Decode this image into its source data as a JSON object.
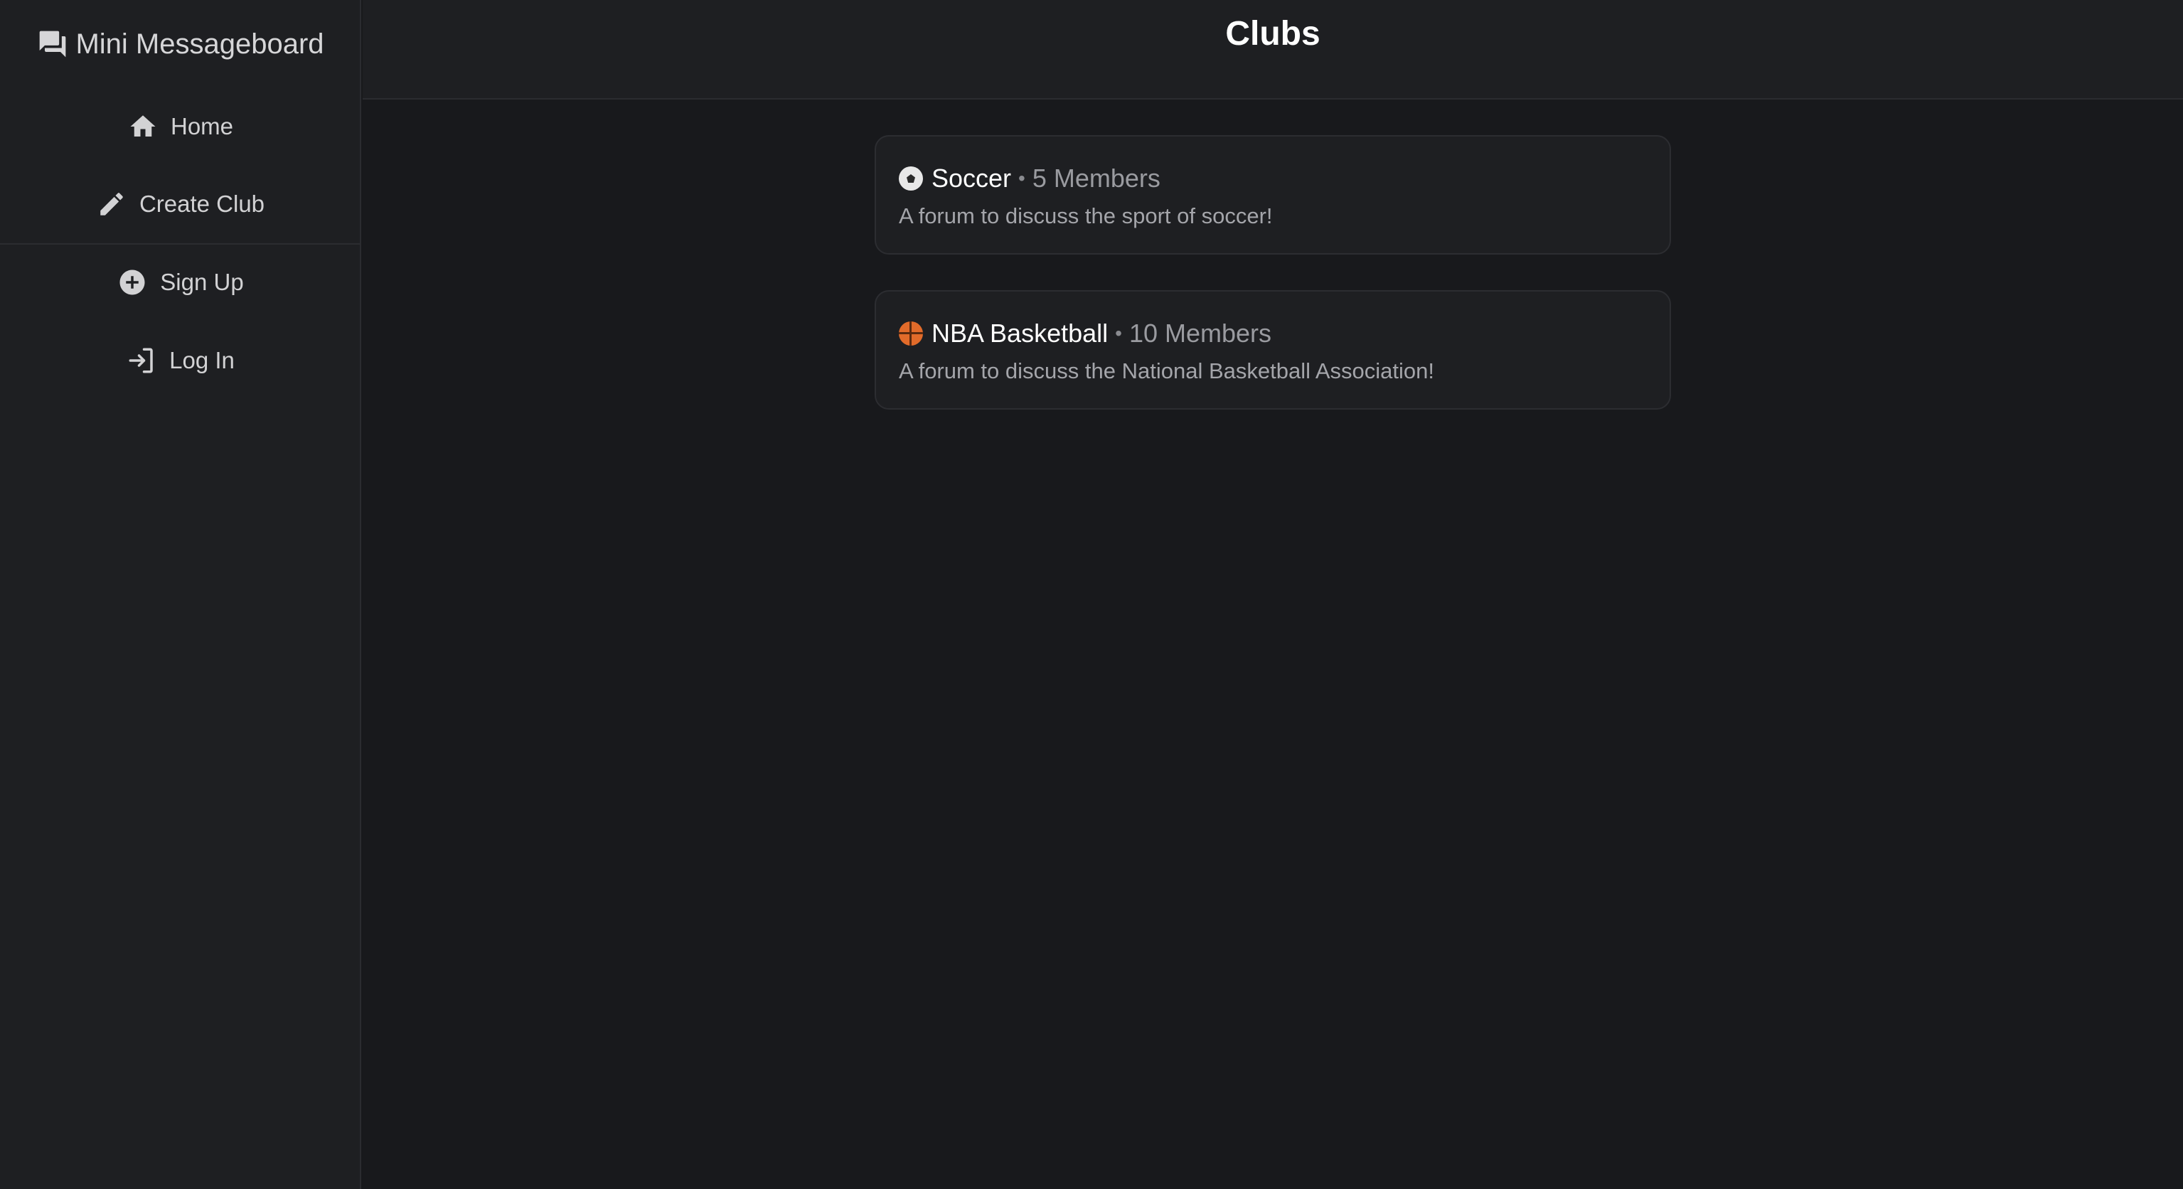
{
  "sidebar": {
    "brand": {
      "label": "Mini Messageboard",
      "icon": "forum-icon"
    },
    "items": [
      {
        "label": "Home",
        "icon": "home-icon"
      },
      {
        "label": "Create Club",
        "icon": "pencil-icon"
      },
      {
        "label": "Sign Up",
        "icon": "plus-circle-icon"
      },
      {
        "label": "Log In",
        "icon": "login-icon"
      }
    ]
  },
  "header": {
    "title": "Clubs"
  },
  "clubs": [
    {
      "emoji": "soccer-ball-icon",
      "name": "Soccer",
      "separator": "•",
      "members": "5 Members",
      "description": "A forum to discuss the sport of soccer!"
    },
    {
      "emoji": "basketball-icon",
      "name": "NBA Basketball",
      "separator": "•",
      "members": "10 Members",
      "description": "A forum to discuss the National Basketball Association!"
    }
  ],
  "colors": {
    "background": "#18191c",
    "panel": "#1e1f22",
    "border": "#2b2c30",
    "text_primary": "#ffffff",
    "text_secondary": "#a4a5aa"
  }
}
